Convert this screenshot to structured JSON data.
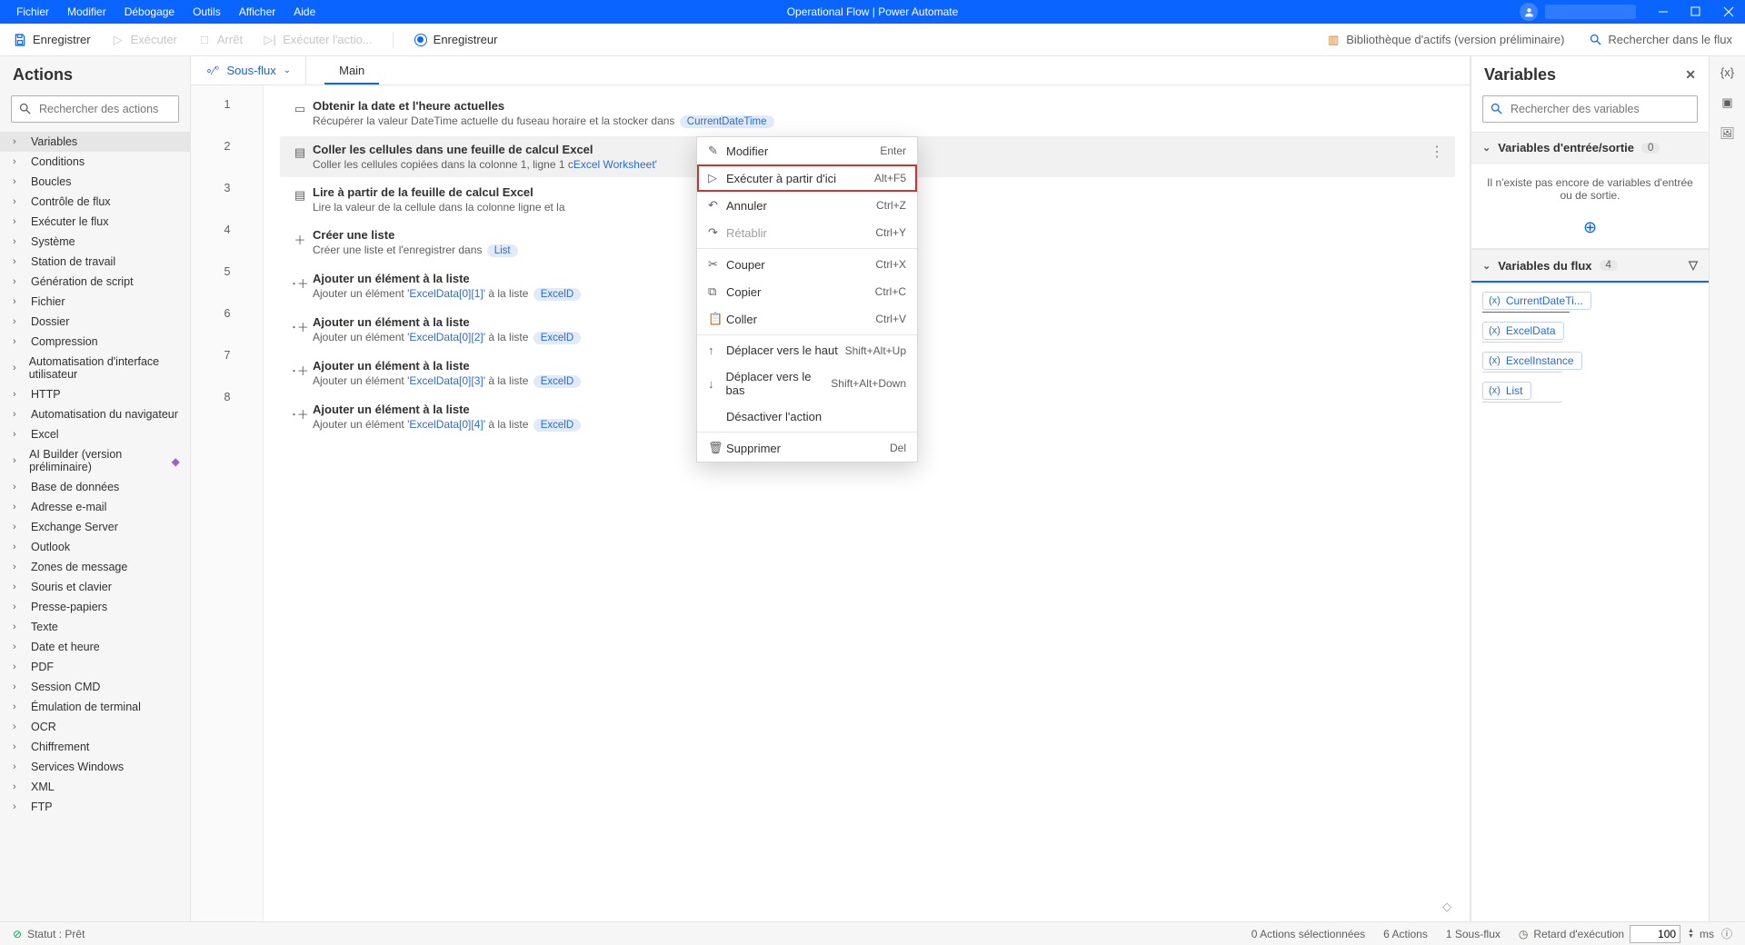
{
  "title": "Operational Flow | Power Automate",
  "menu": [
    "Fichier",
    "Modifier",
    "Débogage",
    "Outils",
    "Afficher",
    "Aide"
  ],
  "toolbar": {
    "save": "Enregistrer",
    "run": "Exécuter",
    "stop": "Arrêt",
    "run_action": "Exécuter l'actio...",
    "recorder": "Enregistreur",
    "asset_lib": "Bibliothèque d'actifs (version préliminaire)",
    "search_flow": "Rechercher dans le flux"
  },
  "actions": {
    "header": "Actions",
    "search_ph": "Rechercher des actions",
    "items": [
      "Variables",
      "Conditions",
      "Boucles",
      "Contrôle de flux",
      "Exécuter le flux",
      "Système",
      "Station de travail",
      "Génération de script",
      "Fichier",
      "Dossier",
      "Compression",
      "Automatisation d'interface utilisateur",
      "HTTP",
      "Automatisation du navigateur",
      "Excel",
      "AI Builder (version préliminaire)",
      "Base de données",
      "Adresse e-mail",
      "Exchange Server",
      "Outlook",
      "Zones de message",
      "Souris et clavier",
      "Presse-papiers",
      "Texte",
      "Date et heure",
      "PDF",
      "Session CMD",
      "Émulation de terminal",
      "OCR",
      "Chiffrement",
      "Services Windows",
      "XML",
      "FTP"
    ],
    "selected_index": 0,
    "ai_builder_index": 15
  },
  "subflow": {
    "label": "Sous-flux",
    "tab": "Main"
  },
  "steps": [
    {
      "line": 1,
      "title": "Obtenir la date et l'heure actuelles",
      "desc_pre": "Récupérer la valeur DateTime actuelle du fuseau horaire et la stocker dans ",
      "pill": "CurrentDateTime"
    },
    {
      "line": 2,
      "title": "Coller les cellules dans une feuille de calcul Excel",
      "desc_pre": "Coller les cellules copiées dans la colonne 1, ligne 1 c",
      "link_tail": "Excel Worksheet'"
    },
    {
      "line": 3,
      "title": "Lire à partir de la feuille de calcul Excel",
      "desc_pre": "Lire la valeur de la cellule dans la colonne  ligne  et la"
    },
    {
      "line": 4,
      "title": "Créer une liste",
      "desc_pre": "Créer une liste et l'enregistrer dans ",
      "pill": "List"
    },
    {
      "line": 5,
      "title": "Ajouter un élément à la liste",
      "desc_pre": "Ajouter un élément ",
      "q": "'ExcelData[0][1]'",
      "desc_mid": " à la liste ",
      "pill": "ExcelD"
    },
    {
      "line": 6,
      "title": "Ajouter un élément à la liste",
      "desc_pre": "Ajouter un élément ",
      "q": "'ExcelData[0][2]'",
      "desc_mid": " à la liste ",
      "pill": "ExcelD"
    },
    {
      "line": 7,
      "title": "Ajouter un élément à la liste",
      "desc_pre": "Ajouter un élément ",
      "q": "'ExcelData[0][3]'",
      "desc_mid": " à la liste ",
      "pill": "ExcelD"
    },
    {
      "line": 8,
      "title": "Ajouter un élément à la liste",
      "desc_pre": "Ajouter un élément ",
      "q": "'ExcelData[0][4]'",
      "desc_mid": " à la liste ",
      "pill": "ExcelD"
    }
  ],
  "context_menu": {
    "items": [
      {
        "label": "Modifier",
        "icon": "edit",
        "shortcut": "Enter"
      },
      {
        "label": "Exécuter à partir d'ici",
        "icon": "play",
        "shortcut": "Alt+F5",
        "highlight": true
      },
      {
        "label": "Annuler",
        "icon": "undo",
        "shortcut": "Ctrl+Z"
      },
      {
        "label": "Rétablir",
        "icon": "redo",
        "shortcut": "Ctrl+Y",
        "disabled": true
      },
      {
        "sep": true
      },
      {
        "label": "Couper",
        "icon": "cut",
        "shortcut": "Ctrl+X"
      },
      {
        "label": "Copier",
        "icon": "copy",
        "shortcut": "Ctrl+C"
      },
      {
        "label": "Coller",
        "icon": "paste",
        "shortcut": "Ctrl+V"
      },
      {
        "sep": true
      },
      {
        "label": "Déplacer vers le haut",
        "icon": "arrow-up",
        "shortcut": "Shift+Alt+Up"
      },
      {
        "label": "Déplacer vers le bas",
        "icon": "arrow-down",
        "shortcut": "Shift+Alt+Down"
      },
      {
        "label": "Désactiver l'action",
        "icon": "",
        "shortcut": ""
      },
      {
        "sep": true
      },
      {
        "label": "Supprimer",
        "icon": "trash",
        "shortcut": "Del"
      }
    ]
  },
  "vars": {
    "header": "Variables",
    "search_ph": "Rechercher des variables",
    "io_head": "Variables d'entrée/sortie",
    "io_count": "0",
    "io_empty": "Il n'existe pas encore de variables d'entrée ou de sortie.",
    "flow_head": "Variables du flux",
    "flow_count": "4",
    "flow_vars": [
      "CurrentDateTi...",
      "ExcelData",
      "ExcelInstance",
      "List"
    ]
  },
  "status": {
    "ready": "Statut : Prêt",
    "selected": "0 Actions sélectionnées",
    "count": "6 Actions",
    "subflows": "1 Sous-flux",
    "delay_label": "Retard d'exécution",
    "delay_value": "100",
    "ms": "ms"
  }
}
